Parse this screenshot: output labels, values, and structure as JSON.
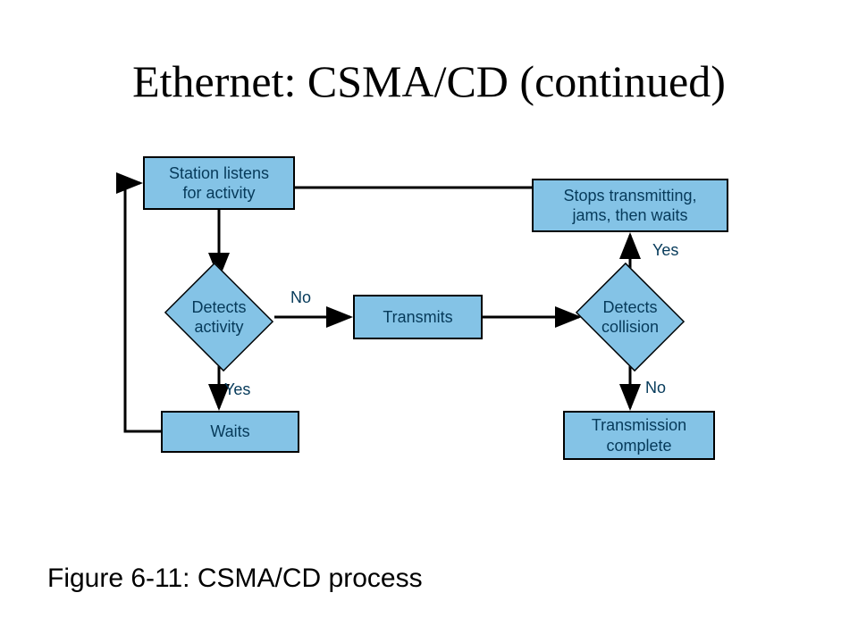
{
  "title": "Ethernet: CSMA/CD (continued)",
  "caption": "Figure 6-11: CSMA/CD process",
  "nodes": {
    "station_listens": "Station listens\nfor activity",
    "stops_transmitting": "Stops transmitting,\njams, then waits",
    "detects_activity": "Detects\nactivity",
    "transmits": "Transmits",
    "detects_collision": "Detects\ncollision",
    "waits": "Waits",
    "transmission_complete": "Transmission\ncomplete"
  },
  "labels": {
    "no1": "No",
    "yes1": "Yes",
    "yes2": "Yes",
    "no2": "No"
  }
}
